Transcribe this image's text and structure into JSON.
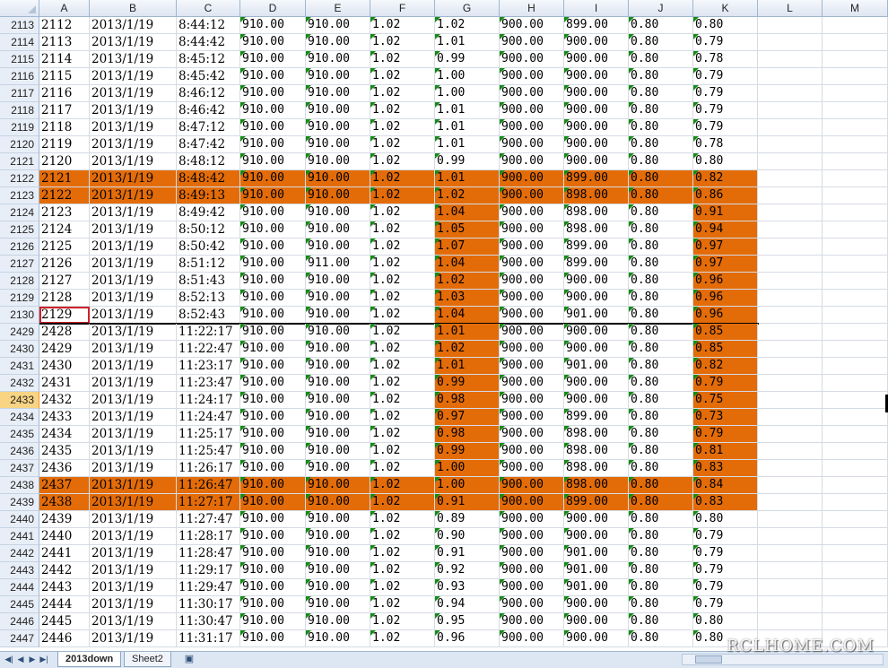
{
  "columns": [
    "A",
    "B",
    "C",
    "D",
    "E",
    "F",
    "G",
    "H",
    "I",
    "J",
    "K",
    "L",
    "M"
  ],
  "rows": [
    {
      "rh": "2113",
      "c": [
        "2112",
        "2013/1/19",
        "8:44:12",
        "910.00",
        "910.00",
        "1.02",
        "1.02",
        "900.00",
        "899.00",
        "0.80",
        "0.80"
      ]
    },
    {
      "rh": "2114",
      "c": [
        "2113",
        "2013/1/19",
        "8:44:42",
        "910.00",
        "910.00",
        "1.02",
        "1.01",
        "900.00",
        "900.00",
        "0.80",
        "0.79"
      ]
    },
    {
      "rh": "2115",
      "c": [
        "2114",
        "2013/1/19",
        "8:45:12",
        "910.00",
        "910.00",
        "1.02",
        "0.99",
        "900.00",
        "900.00",
        "0.80",
        "0.78"
      ]
    },
    {
      "rh": "2116",
      "c": [
        "2115",
        "2013/1/19",
        "8:45:42",
        "910.00",
        "910.00",
        "1.02",
        "1.00",
        "900.00",
        "900.00",
        "0.80",
        "0.79"
      ]
    },
    {
      "rh": "2117",
      "c": [
        "2116",
        "2013/1/19",
        "8:46:12",
        "910.00",
        "910.00",
        "1.02",
        "1.00",
        "900.00",
        "900.00",
        "0.80",
        "0.79"
      ]
    },
    {
      "rh": "2118",
      "c": [
        "2117",
        "2013/1/19",
        "8:46:42",
        "910.00",
        "910.00",
        "1.02",
        "1.01",
        "900.00",
        "900.00",
        "0.80",
        "0.79"
      ]
    },
    {
      "rh": "2119",
      "c": [
        "2118",
        "2013/1/19",
        "8:47:12",
        "910.00",
        "910.00",
        "1.02",
        "1.01",
        "900.00",
        "900.00",
        "0.80",
        "0.79"
      ]
    },
    {
      "rh": "2120",
      "c": [
        "2119",
        "2013/1/19",
        "8:47:42",
        "910.00",
        "910.00",
        "1.02",
        "1.01",
        "900.00",
        "900.00",
        "0.80",
        "0.78"
      ]
    },
    {
      "rh": "2121",
      "c": [
        "2120",
        "2013/1/19",
        "8:48:12",
        "910.00",
        "910.00",
        "1.02",
        "0.99",
        "900.00",
        "900.00",
        "0.80",
        "0.80"
      ]
    },
    {
      "rh": "2122",
      "c": [
        "2121",
        "2013/1/19",
        "8:48:42",
        "910.00",
        "910.00",
        "1.02",
        "1.01",
        "900.00",
        "899.00",
        "0.80",
        "0.82"
      ]
    },
    {
      "rh": "2123",
      "c": [
        "2122",
        "2013/1/19",
        "8:49:13",
        "910.00",
        "910.00",
        "1.02",
        "1.02",
        "900.00",
        "898.00",
        "0.80",
        "0.86"
      ]
    },
    {
      "rh": "2124",
      "c": [
        "2123",
        "2013/1/19",
        "8:49:42",
        "910.00",
        "910.00",
        "1.02",
        "1.04",
        "900.00",
        "898.00",
        "0.80",
        "0.91"
      ]
    },
    {
      "rh": "2125",
      "c": [
        "2124",
        "2013/1/19",
        "8:50:12",
        "910.00",
        "910.00",
        "1.02",
        "1.05",
        "900.00",
        "898.00",
        "0.80",
        "0.94"
      ]
    },
    {
      "rh": "2126",
      "c": [
        "2125",
        "2013/1/19",
        "8:50:42",
        "910.00",
        "910.00",
        "1.02",
        "1.07",
        "900.00",
        "899.00",
        "0.80",
        "0.97"
      ]
    },
    {
      "rh": "2127",
      "c": [
        "2126",
        "2013/1/19",
        "8:51:12",
        "910.00",
        "911.00",
        "1.02",
        "1.04",
        "900.00",
        "899.00",
        "0.80",
        "0.97"
      ]
    },
    {
      "rh": "2128",
      "c": [
        "2127",
        "2013/1/19",
        "8:51:43",
        "910.00",
        "910.00",
        "1.02",
        "1.02",
        "900.00",
        "900.00",
        "0.80",
        "0.96"
      ]
    },
    {
      "rh": "2129",
      "c": [
        "2128",
        "2013/1/19",
        "8:52:13",
        "910.00",
        "910.00",
        "1.02",
        "1.03",
        "900.00",
        "900.00",
        "0.80",
        "0.96"
      ]
    },
    {
      "rh": "2130",
      "c": [
        "2129",
        "2013/1/19",
        "8:52:43",
        "910.00",
        "910.00",
        "1.02",
        "1.04",
        "900.00",
        "901.00",
        "0.80",
        "0.96"
      ]
    },
    {
      "rh": "2429",
      "c": [
        "2428",
        "2013/1/19",
        "11:22:17",
        "910.00",
        "910.00",
        "1.02",
        "1.01",
        "900.00",
        "900.00",
        "0.80",
        "0.85"
      ]
    },
    {
      "rh": "2430",
      "c": [
        "2429",
        "2013/1/19",
        "11:22:47",
        "910.00",
        "910.00",
        "1.02",
        "1.02",
        "900.00",
        "900.00",
        "0.80",
        "0.85"
      ]
    },
    {
      "rh": "2431",
      "c": [
        "2430",
        "2013/1/19",
        "11:23:17",
        "910.00",
        "910.00",
        "1.02",
        "1.01",
        "900.00",
        "901.00",
        "0.80",
        "0.82"
      ]
    },
    {
      "rh": "2432",
      "c": [
        "2431",
        "2013/1/19",
        "11:23:47",
        "910.00",
        "910.00",
        "1.02",
        "0.99",
        "900.00",
        "900.00",
        "0.80",
        "0.79"
      ]
    },
    {
      "rh": "2433",
      "c": [
        "2432",
        "2013/1/19",
        "11:24:17",
        "910.00",
        "910.00",
        "1.02",
        "0.98",
        "900.00",
        "900.00",
        "0.80",
        "0.75"
      ]
    },
    {
      "rh": "2434",
      "c": [
        "2433",
        "2013/1/19",
        "11:24:47",
        "910.00",
        "910.00",
        "1.02",
        "0.97",
        "900.00",
        "899.00",
        "0.80",
        "0.73"
      ]
    },
    {
      "rh": "2435",
      "c": [
        "2434",
        "2013/1/19",
        "11:25:17",
        "910.00",
        "910.00",
        "1.02",
        "0.98",
        "900.00",
        "898.00",
        "0.80",
        "0.79"
      ]
    },
    {
      "rh": "2436",
      "c": [
        "2435",
        "2013/1/19",
        "11:25:47",
        "910.00",
        "910.00",
        "1.02",
        "0.99",
        "900.00",
        "898.00",
        "0.80",
        "0.81"
      ]
    },
    {
      "rh": "2437",
      "c": [
        "2436",
        "2013/1/19",
        "11:26:17",
        "910.00",
        "910.00",
        "1.02",
        "1.00",
        "900.00",
        "898.00",
        "0.80",
        "0.83"
      ]
    },
    {
      "rh": "2438",
      "c": [
        "2437",
        "2013/1/19",
        "11:26:47",
        "910.00",
        "910.00",
        "1.02",
        "1.00",
        "900.00",
        "898.00",
        "0.80",
        "0.84"
      ]
    },
    {
      "rh": "2439",
      "c": [
        "2438",
        "2013/1/19",
        "11:27:17",
        "910.00",
        "910.00",
        "1.02",
        "0.91",
        "900.00",
        "899.00",
        "0.80",
        "0.83"
      ]
    },
    {
      "rh": "2440",
      "c": [
        "2439",
        "2013/1/19",
        "11:27:47",
        "910.00",
        "910.00",
        "1.02",
        "0.89",
        "900.00",
        "900.00",
        "0.80",
        "0.80"
      ]
    },
    {
      "rh": "2441",
      "c": [
        "2440",
        "2013/1/19",
        "11:28:17",
        "910.00",
        "910.00",
        "1.02",
        "0.90",
        "900.00",
        "900.00",
        "0.80",
        "0.79"
      ]
    },
    {
      "rh": "2442",
      "c": [
        "2441",
        "2013/1/19",
        "11:28:47",
        "910.00",
        "910.00",
        "1.02",
        "0.91",
        "900.00",
        "901.00",
        "0.80",
        "0.79"
      ]
    },
    {
      "rh": "2443",
      "c": [
        "2442",
        "2013/1/19",
        "11:29:17",
        "910.00",
        "910.00",
        "1.02",
        "0.92",
        "900.00",
        "901.00",
        "0.80",
        "0.79"
      ]
    },
    {
      "rh": "2444",
      "c": [
        "2443",
        "2013/1/19",
        "11:29:47",
        "910.00",
        "910.00",
        "1.02",
        "0.93",
        "900.00",
        "901.00",
        "0.80",
        "0.79"
      ]
    },
    {
      "rh": "2445",
      "c": [
        "2444",
        "2013/1/19",
        "11:30:17",
        "910.00",
        "910.00",
        "1.02",
        "0.94",
        "900.00",
        "900.00",
        "0.80",
        "0.79"
      ]
    },
    {
      "rh": "2446",
      "c": [
        "2445",
        "2013/1/19",
        "11:30:47",
        "910.00",
        "910.00",
        "1.02",
        "0.95",
        "900.00",
        "900.00",
        "0.80",
        "0.80"
      ]
    },
    {
      "rh": "2447",
      "c": [
        "2446",
        "2013/1/19",
        "11:31:17",
        "910.00",
        "910.00",
        "1.02",
        "0.96",
        "900.00",
        "900.00",
        "0.80",
        "0.80"
      ]
    }
  ],
  "highlight": {
    "color": "#e36c09",
    "full_rows": [
      "2122",
      "2123",
      "2438",
      "2439"
    ],
    "column_G_rows": [
      "2124",
      "2125",
      "2126",
      "2127",
      "2128",
      "2129",
      "2130",
      "2429",
      "2430",
      "2431",
      "2432",
      "2433",
      "2434",
      "2435",
      "2436",
      "2437"
    ],
    "column_K_rows": [
      "2124",
      "2125",
      "2126",
      "2127",
      "2128",
      "2129",
      "2130",
      "2429",
      "2430",
      "2431",
      "2432",
      "2433",
      "2434",
      "2435",
      "2436",
      "2437"
    ]
  },
  "selected_row_header": "2433",
  "active_cell": {
    "row": "2130",
    "column": "A"
  },
  "sheet_tabs": {
    "nav_buttons": [
      "first-sheet",
      "prev-sheet",
      "next-sheet",
      "last-sheet"
    ],
    "tabs": [
      {
        "label": "2013down",
        "active": true
      },
      {
        "label": "Sheet2",
        "active": false
      }
    ],
    "new_sheet_icon": "new-sheet-icon"
  },
  "watermark": "RCLHOME.COM"
}
